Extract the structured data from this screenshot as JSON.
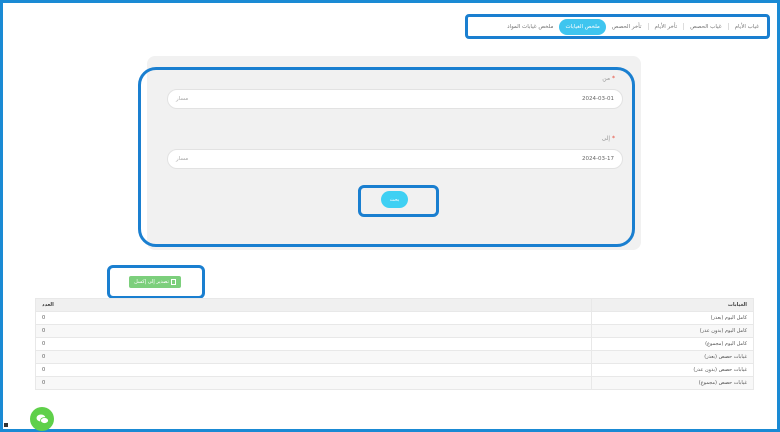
{
  "tabs": [
    {
      "label": "غياب الأيام",
      "active": false
    },
    {
      "label": "غياب الحصص",
      "active": false
    },
    {
      "label": "تأخر الأيام",
      "active": false
    },
    {
      "label": "تأخر الحصص",
      "active": false
    },
    {
      "label": "ملخص الغيابات",
      "active": true
    },
    {
      "label": "ملخص غيابات المواد",
      "active": false
    }
  ],
  "form": {
    "from_label": "من",
    "from_value": "2024-03-01",
    "from_placeholder": "مسار",
    "to_label": "إلى",
    "to_value": "2024-03-17",
    "to_placeholder": "مسار",
    "required_mark": "*",
    "search_label": "بحث"
  },
  "export": {
    "label": "تصدير إلى إكسل"
  },
  "table": {
    "headers": {
      "type": "الغيابات",
      "count": "العدد"
    },
    "rows": [
      {
        "type": "كامل اليوم (بعذر)",
        "count": "0"
      },
      {
        "type": "كامل اليوم (بدون عذر)",
        "count": "0"
      },
      {
        "type": "كامل اليوم (مجموع)",
        "count": "0"
      },
      {
        "type": "غيابات حصص (بعذر)",
        "count": "0"
      },
      {
        "type": "غيابات حصص (بدون عذر)",
        "count": "0"
      },
      {
        "type": "غيابات حصص (مجموع)",
        "count": "0"
      }
    ]
  },
  "colors": {
    "accent": "#3fc5ef",
    "highlight_frame": "#1a7fd0",
    "export_green": "#7ccf7c",
    "chat_green": "#5fd04a"
  },
  "icons": {
    "export": "document-icon",
    "chat": "chat-bubble-icon"
  }
}
